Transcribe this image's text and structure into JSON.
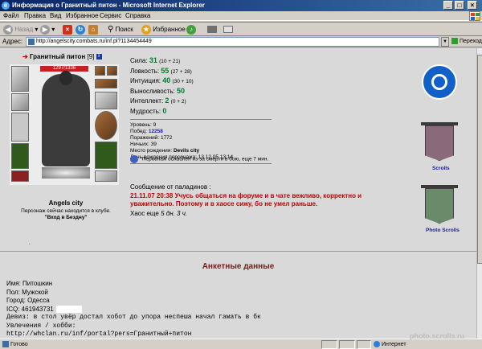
{
  "window": {
    "title": "Информация о Гранитный питон - Microsoft Internet Explorer",
    "app_icon": "ie-icon"
  },
  "menu": {
    "items": [
      "Файл",
      "Правка",
      "Вид",
      "Избранное",
      "Сервис",
      "Справка"
    ]
  },
  "toolbar": {
    "back_label": "Назад",
    "search_label": "Поиск",
    "favorites_label": "Избранное"
  },
  "address": {
    "label": "Адрес:",
    "url": "http://angelscity.combats.ru/inf.pl?1134454449",
    "go_label": "Переход"
  },
  "character": {
    "name": "Гранитный питон",
    "level": "[9]",
    "hp": "1297/1336",
    "location_city": "Angels city",
    "location_text": "Персонаж сейчас находится в клубе.",
    "location_place": "\"Вход в Бездну\""
  },
  "stats": [
    {
      "label": "Сила:",
      "value": "31",
      "mod": "(10 + 21)"
    },
    {
      "label": "Ловкость:",
      "value": "55",
      "mod": "(27 + 28)"
    },
    {
      "label": "Интуиция:",
      "value": "40",
      "mod": "(30 + 10)"
    },
    {
      "label": "Выносливость:",
      "value": "50",
      "mod": ""
    },
    {
      "label": "Интеллект:",
      "value": "2",
      "mod": "(0 + 2)"
    },
    {
      "label": "Мудрость:",
      "value": "0",
      "mod": ""
    }
  ],
  "info": {
    "level_label": "Уровень:",
    "level_value": "9",
    "wins_label": "Побед:",
    "wins_value": "12258",
    "losses_label": "Поражений:",
    "losses_value": "1772",
    "draws_label": "Ничьих:",
    "draws_value": "39",
    "birthplace_label": "Место рождения:",
    "birthplace_value": "Devils city",
    "birthday_label": "День рождения персонажа:",
    "birthday_value": "13.12.05 13:14"
  },
  "penalty": {
    "text": "Персонаж ослаблен из-за смерти в бою, еще 7 мин."
  },
  "paladin": {
    "header": "Сообщение от паладинов :",
    "message": "21.11.07 20:38 Учусь общаться на форуме и в чате вежливо, корректно и уважительно. Поэтому и в хаосе сижу, бо не умел раньше.",
    "chaos_prefix": "Хаос еще",
    "chaos_time": "5 дн. 3 ч."
  },
  "side": {
    "scrolls_label": "Scrolls",
    "photo_label": "Photo Scrolls"
  },
  "anketa": {
    "title": "Анкетные данные",
    "name": "Имя: Питошкин",
    "gender": "Пол: Мужской",
    "city": "Город: Одесса",
    "icq": "ICQ: 461943731",
    "motto": "Девиз: в стол увёр достал хобот до упора неспеша начал гамать в бк",
    "hobby": "Увлечения / хобби:",
    "link": "http://whclan.ru/inf/portal?pers=Гранитный+питон"
  },
  "status": {
    "ready": "Готово",
    "zone": "Интернет"
  },
  "watermark": "photo.scrolls.ru",
  "colors": {
    "stat_value": "#00802b",
    "paladin_message": "#c00000",
    "link_blue": "#1a1aa0",
    "title_bar": "#0a246a"
  }
}
